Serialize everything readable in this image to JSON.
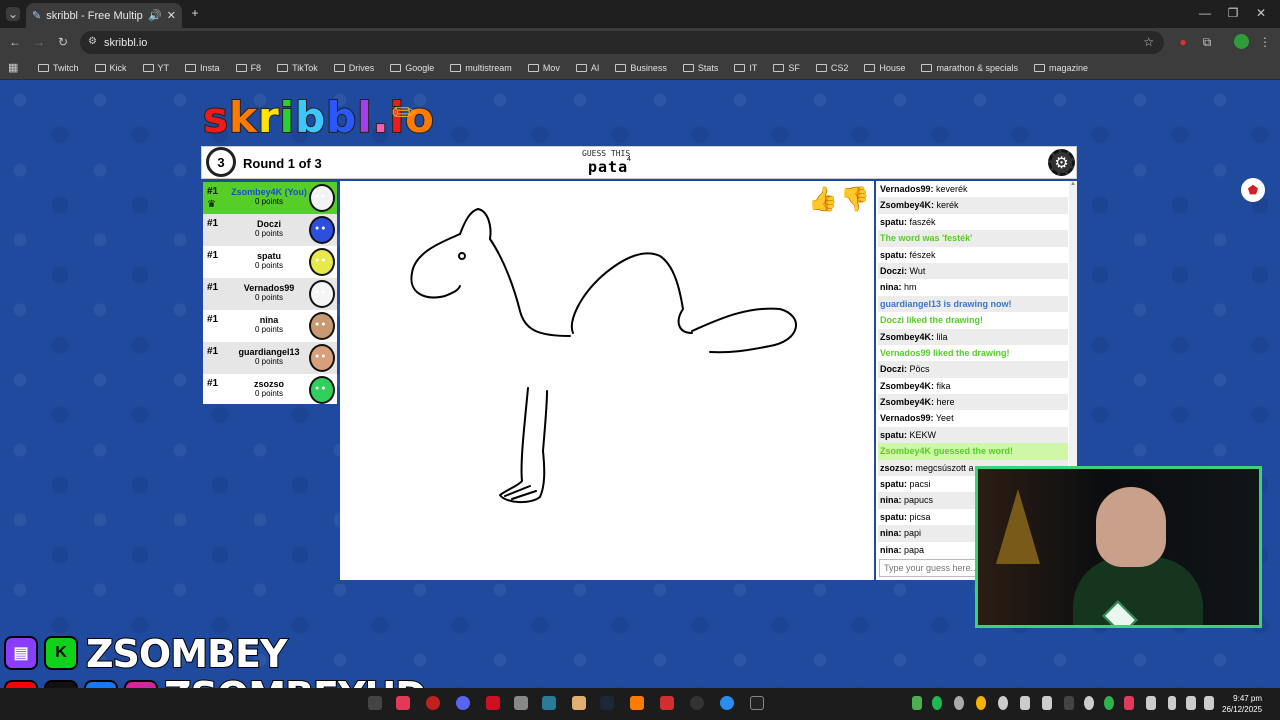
{
  "browser": {
    "tab_title": "skribbl - Free Multiplayer D",
    "url": "skribbl.io",
    "bookmarks": [
      "Twitch",
      "Kick",
      "YT",
      "Insta",
      "F8",
      "TikTok",
      "Drives",
      "Google",
      "multistream",
      "Mov",
      "AI",
      "Business",
      "Stats",
      "IT",
      "SF",
      "CS2",
      "House",
      "marathon & specials",
      "magazine"
    ]
  },
  "game": {
    "logo_letters": [
      "s",
      "k",
      "r",
      "i",
      "b",
      "b",
      "l",
      ".",
      "i",
      "o"
    ],
    "logo_colors": [
      "#ef1b1b",
      "#ff7a00",
      "#ffe200",
      "#2bd134",
      "#3fc6ff",
      "#2b57ff",
      "#a43ff0",
      "#ff5bb6",
      "#ef1b1b",
      "#ff7a00"
    ],
    "timer": "3",
    "round_label": "Round 1 of 3",
    "guess_label": "GUESS THIS",
    "word": "pata",
    "word_length": "4"
  },
  "players": [
    {
      "rank": "#1",
      "name": "Zsombey4K (You)",
      "points": "0 points",
      "color": "#f3f3f3",
      "crown": "♛"
    },
    {
      "rank": "#1",
      "name": "Doczi",
      "points": "0 points",
      "color": "#2c4fe0"
    },
    {
      "rank": "#1",
      "name": "spatu",
      "points": "0 points",
      "color": "#e7e84a"
    },
    {
      "rank": "#1",
      "name": "Vernados99",
      "points": "0 points",
      "color": "#f5f5f5"
    },
    {
      "rank": "#1",
      "name": "nina",
      "points": "0 points",
      "color": "#c99a72"
    },
    {
      "rank": "#1",
      "name": "guardiangel13",
      "points": "0 points",
      "color": "#d8a07a"
    },
    {
      "rank": "#1",
      "name": "zsozso",
      "points": "0 points",
      "color": "#2fd05c"
    }
  ],
  "chat": [
    {
      "who": "Vernados99:",
      "text": "keverék",
      "type": "msg"
    },
    {
      "who": "Zsombey4K:",
      "text": "kerék",
      "type": "msg"
    },
    {
      "who": "spatu:",
      "text": "faszék",
      "type": "msg"
    },
    {
      "who": "",
      "text": "The word was 'festék'",
      "type": "sys-g"
    },
    {
      "who": "spatu:",
      "text": "fészek",
      "type": "msg"
    },
    {
      "who": "Doczi:",
      "text": "Wut",
      "type": "msg"
    },
    {
      "who": "nina:",
      "text": "hm",
      "type": "msg"
    },
    {
      "who": "",
      "text": "guardiangel13 is drawing now!",
      "type": "sys-b"
    },
    {
      "who": "",
      "text": "Doczi liked the drawing!",
      "type": "sys-g"
    },
    {
      "who": "Zsombey4K:",
      "text": "lila",
      "type": "msg"
    },
    {
      "who": "",
      "text": "Vernados99 liked the drawing!",
      "type": "sys-g"
    },
    {
      "who": "Doczi:",
      "text": "Pöcs",
      "type": "msg"
    },
    {
      "who": "Zsombey4K:",
      "text": "fika",
      "type": "msg"
    },
    {
      "who": "Zsombey4K:",
      "text": "here",
      "type": "msg"
    },
    {
      "who": "Vernados99:",
      "text": "Yeet",
      "type": "msg"
    },
    {
      "who": "spatu:",
      "text": "KEKW",
      "type": "msg"
    },
    {
      "who": "",
      "text": "Zsombey4K guessed the word!",
      "type": "hl"
    },
    {
      "who": "zsozso:",
      "text": "megcsúszott a",
      "type": "msg"
    },
    {
      "who": "spatu:",
      "text": "pacsi",
      "type": "msg"
    },
    {
      "who": "nina:",
      "text": "papucs",
      "type": "msg"
    },
    {
      "who": "spatu:",
      "text": "picsa",
      "type": "msg"
    },
    {
      "who": "nina:",
      "text": "papi",
      "type": "msg"
    },
    {
      "who": "nina:",
      "text": "papa",
      "type": "msg"
    }
  ],
  "chat_placeholder": "Type your guess here...",
  "branding": {
    "line1": "ZSOMBEY",
    "line2": "ZSOMBEYHD"
  },
  "taskbar": {
    "time": "9:47 pm",
    "date": "26/12/2025"
  }
}
